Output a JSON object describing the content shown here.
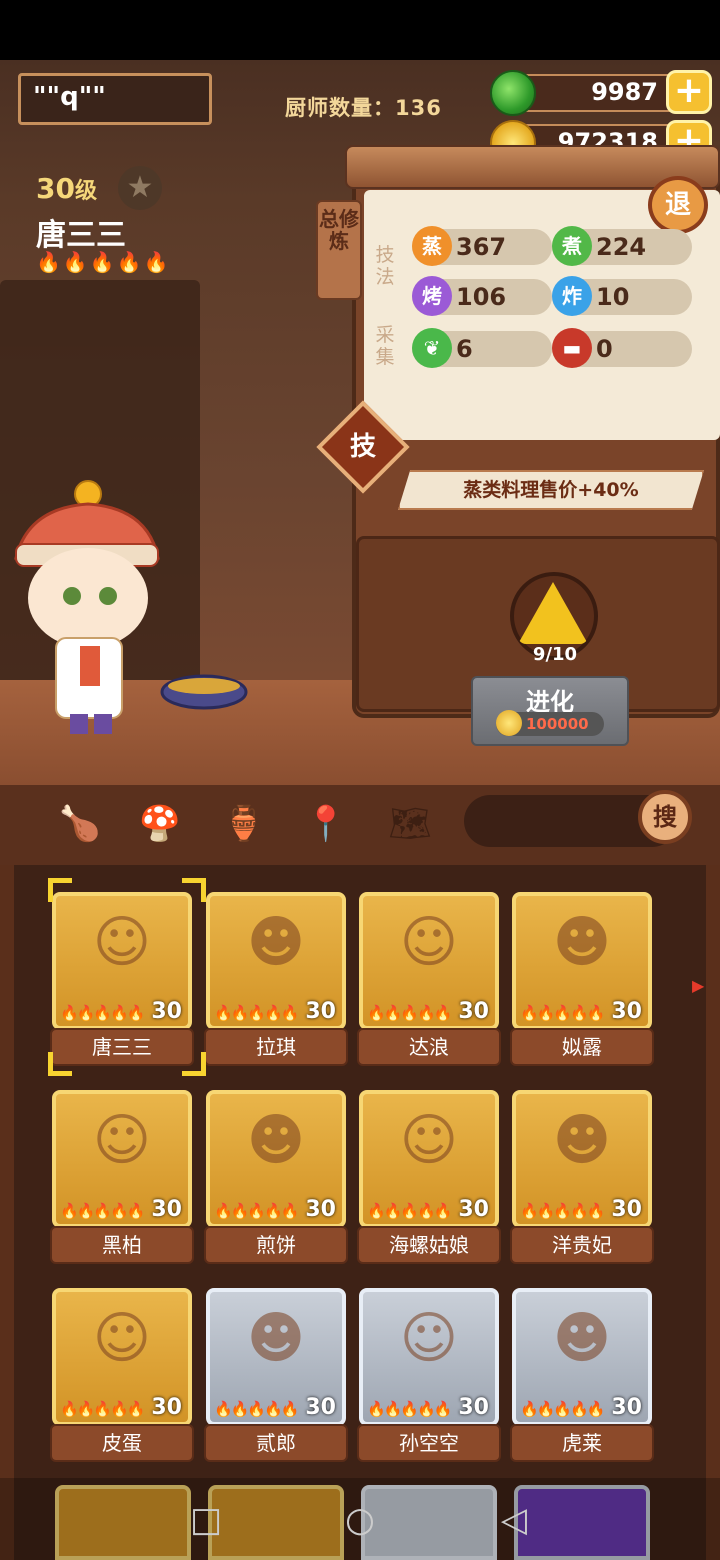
{
  "header": {
    "player_name": "\"\"q\"\"",
    "chef_count_label": "厨师数量：",
    "chef_count": "136"
  },
  "resources": {
    "jade": "9987",
    "coins": "972318",
    "plus": "+"
  },
  "character": {
    "level": "30",
    "level_unit": "级",
    "name": "唐三三",
    "flames": 5
  },
  "panel": {
    "total_tab": "总修炼",
    "exit": "退",
    "technique_label": "技法",
    "gather_label": "采集",
    "skills": [
      {
        "icon": "蒸",
        "value": "367",
        "color": "#f0902a"
      },
      {
        "icon": "煮",
        "value": "224",
        "color": "#52b848"
      },
      {
        "icon": "烤",
        "value": "106",
        "color": "#9b5ad6"
      },
      {
        "icon": "炸",
        "value": "10",
        "color": "#3aa2e8"
      },
      {
        "icon": "cabbage-icon",
        "value": "6",
        "color": "#4ab84a"
      },
      {
        "icon": "meat-icon",
        "value": "0",
        "color": "#c8392a"
      }
    ],
    "skill_badge": "技",
    "bonus_text": "蒸类料理售价+40%",
    "evolve": {
      "progress": "9/10",
      "label": "进化",
      "cost": "100000"
    }
  },
  "filters": {
    "icons": [
      "drumstick-icon",
      "mushroom-icon",
      "jar-icon",
      "map-pin-icon",
      "map-icon"
    ],
    "search_button": "搜"
  },
  "chefs": [
    {
      "name": "唐三三",
      "level": "30",
      "frame": "gold",
      "selected": true
    },
    {
      "name": "拉琪",
      "level": "30",
      "frame": "gold"
    },
    {
      "name": "达浪",
      "level": "30",
      "frame": "gold"
    },
    {
      "name": "姒露",
      "level": "30",
      "frame": "gold"
    },
    {
      "name": "黑柏",
      "level": "30",
      "frame": "gold"
    },
    {
      "name": "煎饼",
      "level": "30",
      "frame": "gold"
    },
    {
      "name": "海螺姑娘",
      "level": "30",
      "frame": "gold"
    },
    {
      "name": "洋贵妃",
      "level": "30",
      "frame": "gold"
    },
    {
      "name": "皮蛋",
      "level": "30",
      "frame": "gold"
    },
    {
      "name": "贰郎",
      "level": "30",
      "frame": "silver"
    },
    {
      "name": "孙空空",
      "level": "30",
      "frame": "silver"
    },
    {
      "name": "虎莱",
      "level": "30",
      "frame": "silver"
    }
  ],
  "system_nav": [
    "square-icon",
    "circle-icon",
    "triangle-back-icon"
  ]
}
